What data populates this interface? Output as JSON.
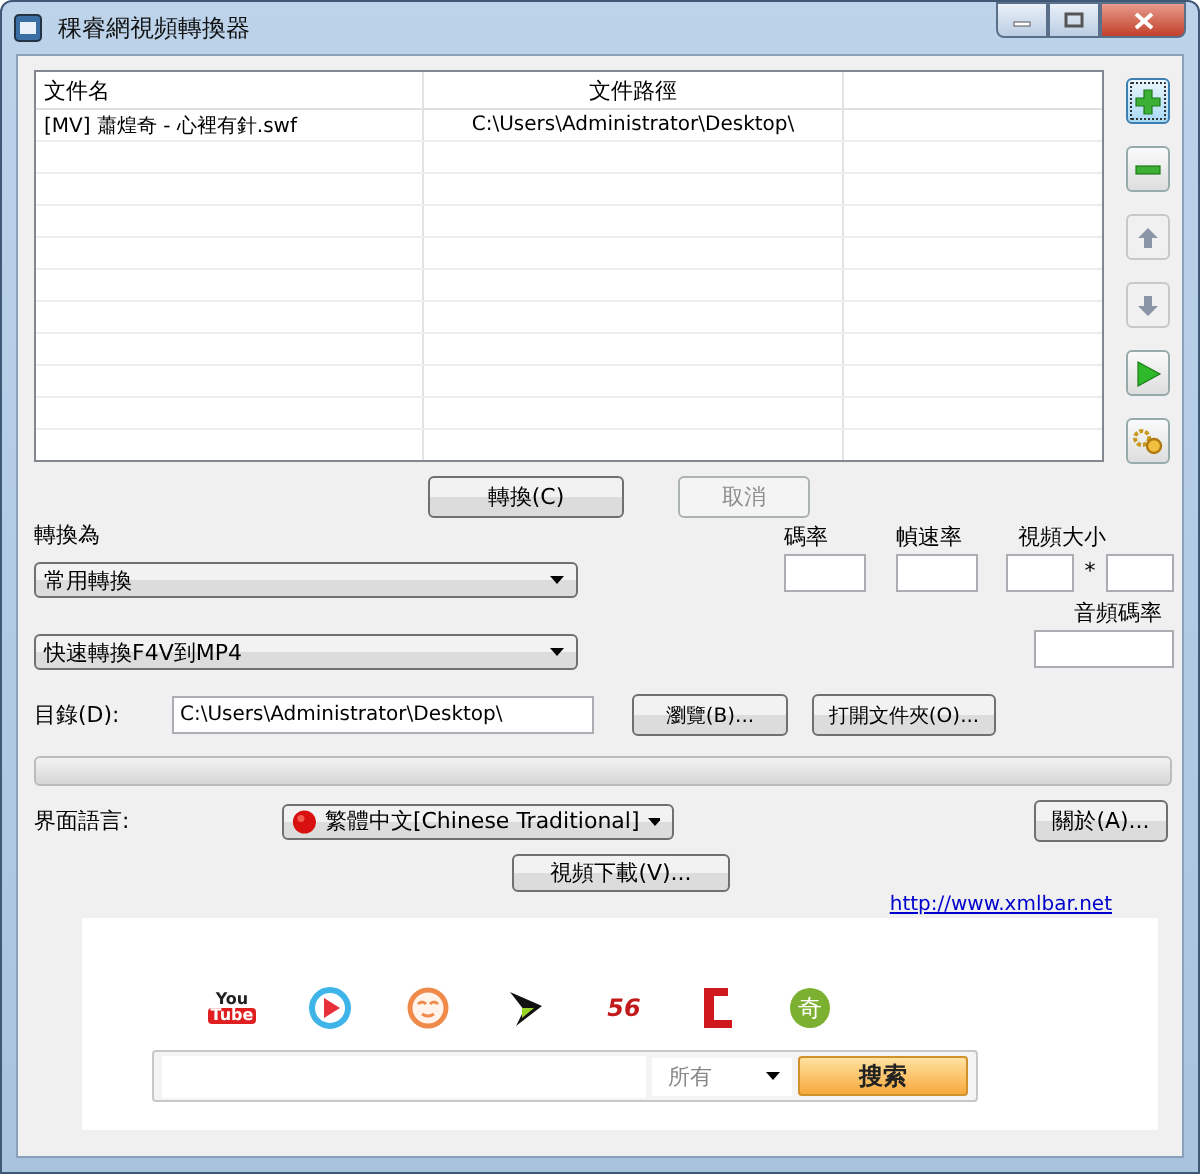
{
  "window": {
    "title": "稞睿網視頻轉換器"
  },
  "file_table": {
    "columns": [
      {
        "label": "文件名"
      },
      {
        "label": "文件路徑"
      }
    ],
    "rows": [
      {
        "name": "[MV] 蕭煌奇 - 心裡有針.swf",
        "path": "C:\\Users\\Administrator\\Desktop\\"
      }
    ]
  },
  "side_buttons": [
    {
      "kind": "add",
      "disabled": false,
      "focused": true
    },
    {
      "kind": "remove",
      "disabled": false,
      "focused": false
    },
    {
      "kind": "up",
      "disabled": true,
      "focused": false
    },
    {
      "kind": "down",
      "disabled": true,
      "focused": false
    },
    {
      "kind": "start",
      "disabled": false,
      "focused": false
    },
    {
      "kind": "settings",
      "disabled": false,
      "focused": false
    }
  ],
  "actions": [
    {
      "label": "轉換(C)",
      "disabled": false
    },
    {
      "label": "取消",
      "disabled": true
    }
  ],
  "convert_to": {
    "label": "轉換為",
    "category": "常用轉換",
    "preset": "快速轉換F4V到MP4"
  },
  "params": {
    "bitrate_label": "碼率",
    "fps_label": "幀速率",
    "size_label": "視頻大小",
    "size_separator": "*",
    "audio_bitrate_label": "音頻碼率"
  },
  "directory": {
    "label": "目錄(D):",
    "value": "C:\\Users\\Administrator\\Desktop\\",
    "browse": "瀏覽(B)...",
    "open_folder": "打開文件夾(O)..."
  },
  "progress": {
    "level": 0
  },
  "language": {
    "label": "界面語言:",
    "value": "繁體中文[Chinese Traditional]",
    "about": "關於(A)..."
  },
  "download_button": "視頻下載(V)...",
  "link": "http://www.xmlbar.net",
  "sites": [
    {
      "kind": "youtube",
      "top": "You",
      "bottom": "Tube"
    },
    {
      "kind": "play"
    },
    {
      "kind": "face"
    },
    {
      "kind": "bolt"
    },
    {
      "kind": "number",
      "text": "56"
    },
    {
      "kind": "bracket"
    },
    {
      "kind": "bubble",
      "text": "奇"
    }
  ],
  "search": {
    "scope": "所有",
    "button": "搜索"
  }
}
